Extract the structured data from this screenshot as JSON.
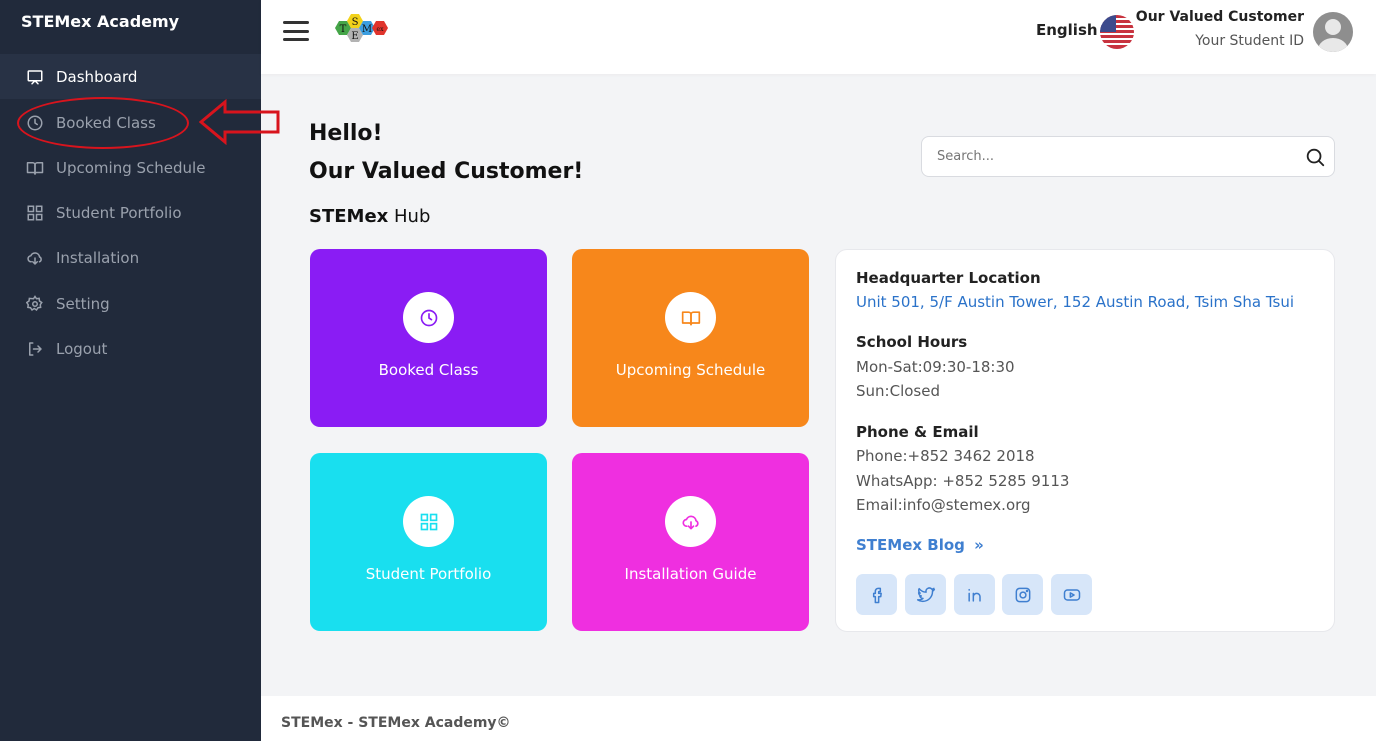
{
  "app": {
    "brand": "STEMex Academy"
  },
  "sidebar": {
    "items": [
      {
        "label": "Dashboard",
        "icon": "monitor-icon"
      },
      {
        "label": "Booked Class",
        "icon": "clock-icon"
      },
      {
        "label": "Upcoming Schedule",
        "icon": "book-icon"
      },
      {
        "label": "Student Portfolio",
        "icon": "grid-icon"
      },
      {
        "label": "Installation",
        "icon": "cloud-download-icon"
      },
      {
        "label": "Setting",
        "icon": "gear-icon"
      },
      {
        "label": "Logout",
        "icon": "logout-icon"
      }
    ]
  },
  "topbar": {
    "language": "English",
    "user_name": "Our Valued Customer",
    "user_id": "Your Student ID",
    "logo_letters": [
      "T",
      "S",
      "E",
      "M",
      "ex"
    ]
  },
  "main": {
    "greeting": "Hello!",
    "customer": "Our Valued Customer!",
    "hub_brand": "STEMex",
    "hub_word": "Hub",
    "search_placeholder": "Search..."
  },
  "tiles": [
    {
      "label": "Booked Class",
      "icon": "clock-icon",
      "color": "#8a1cf4"
    },
    {
      "label": "Upcoming Schedule",
      "icon": "book-icon",
      "color": "#f7871b"
    },
    {
      "label": "Student Portfolio",
      "icon": "grid-icon",
      "color": "#19dfef"
    },
    {
      "label": "Installation Guide",
      "icon": "cloud-download-icon",
      "color": "#ef2fe0"
    }
  ],
  "info": {
    "hq_heading": "Headquarter Location",
    "hq_address": "Unit 501, 5/F Austin Tower, 152 Austin Road, Tsim Sha Tsui",
    "hours_heading": "School Hours",
    "hours_weekday": "Mon-Sat:09:30-18:30",
    "hours_sunday": "Sun:Closed",
    "contact_heading": "Phone & Email",
    "phone": "Phone:+852 3462 2018",
    "whatsapp": "WhatsApp: +852 5285 9113",
    "email": "Email:info@stemex.org",
    "blog": "STEMex Blog",
    "social": [
      "facebook-icon",
      "twitter-icon",
      "linkedin-icon",
      "instagram-icon",
      "youtube-icon"
    ]
  },
  "footer": {
    "text": "STEMex -  STEMex Academy©"
  },
  "colors": {
    "sidebar": "#212a3b",
    "accent_blue": "#2a72c9",
    "annotation_red": "#d8141d"
  }
}
